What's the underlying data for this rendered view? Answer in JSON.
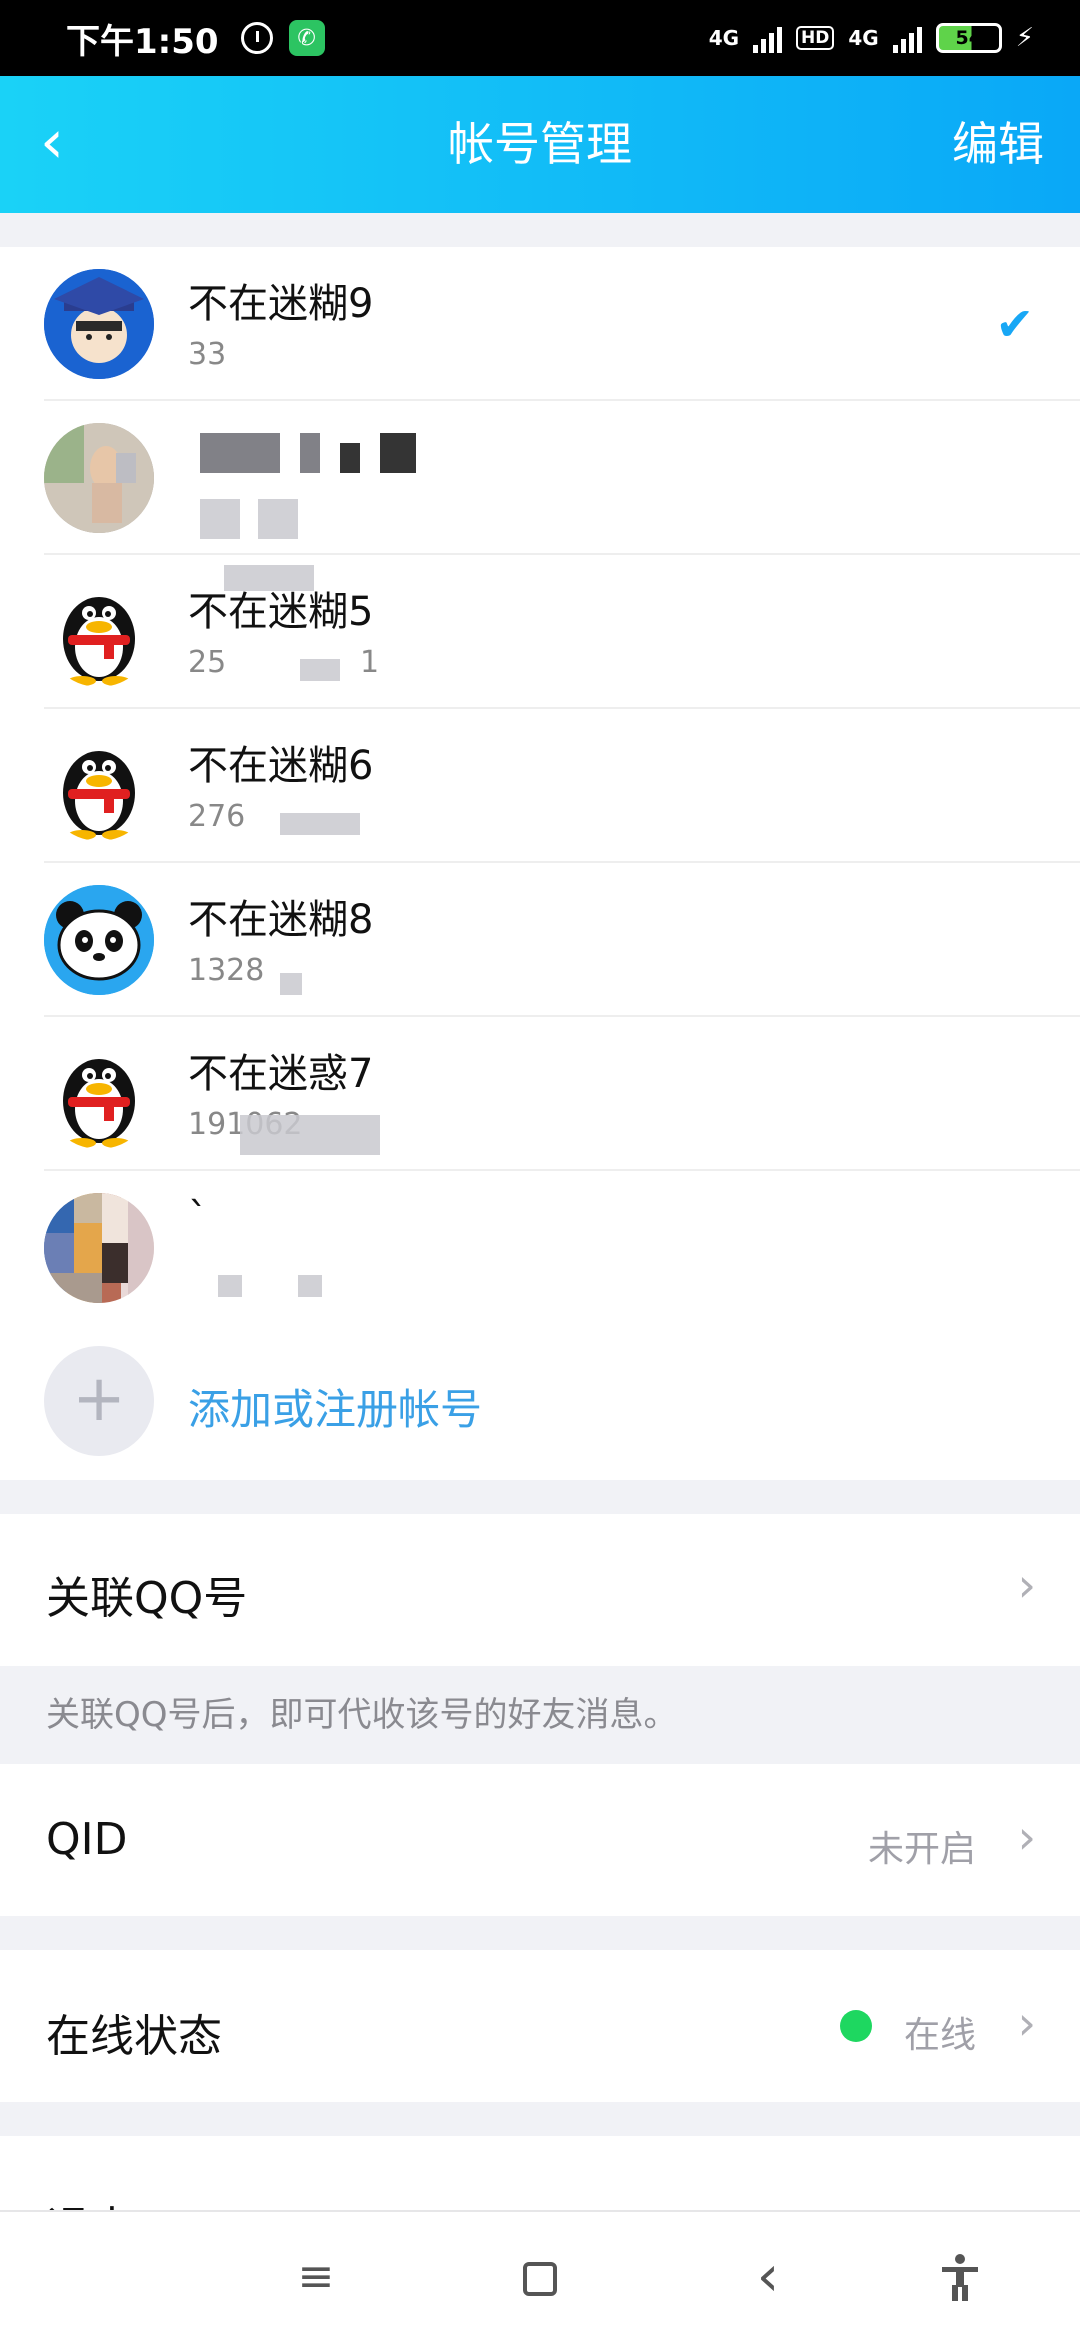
{
  "status_bar": {
    "time": "下午1:50",
    "network1": "4G",
    "hd": "HD",
    "network2": "4G",
    "battery": "54"
  },
  "header": {
    "title": "帐号管理",
    "edit_label": "编辑",
    "back_icon": "chevron-left-icon"
  },
  "accounts": [
    {
      "name": "不在迷糊9",
      "id_prefix": "33",
      "selected": true
    },
    {
      "name": "",
      "id_prefix": "",
      "selected": false
    },
    {
      "name": "不在迷糊5",
      "id_prefix": "25",
      "id_suffix": "1",
      "selected": false
    },
    {
      "name": "不在迷糊6",
      "id_prefix": "276",
      "selected": false
    },
    {
      "name": "不在迷糊8",
      "id_prefix": "1328",
      "selected": false
    },
    {
      "name": "不在迷惑7",
      "id_prefix": "191062",
      "selected": false
    },
    {
      "name": "`",
      "id_prefix": "",
      "selected": false
    }
  ],
  "add_account_label": "添加或注册帐号",
  "link_qq": {
    "label": "关联QQ号",
    "hint": "关联QQ号后，即可代收该号的好友消息。"
  },
  "qid": {
    "label": "QID",
    "value": "未开启"
  },
  "online_status": {
    "label": "在线状态",
    "value": "在线",
    "dot_color": "#1ed760"
  },
  "logout_label": "退出",
  "colors": {
    "header_start": "#1ad2f7",
    "header_end": "#0aa8f7",
    "accent": "#18a7f5"
  }
}
